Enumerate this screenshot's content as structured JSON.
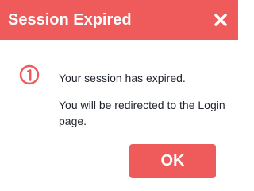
{
  "dialog": {
    "title": "Session Expired",
    "close_icon": "close-icon",
    "alert_icon": "alert-circle-icon",
    "message_line_1": "Your session has expired.",
    "message_line_2": "You will be redirected to the Login page.",
    "ok_label": "OK",
    "colors": {
      "accent": "#ef5a5b",
      "header_text": "#ffffff",
      "body_text": "#1f2430",
      "background": "#ffffff"
    }
  }
}
